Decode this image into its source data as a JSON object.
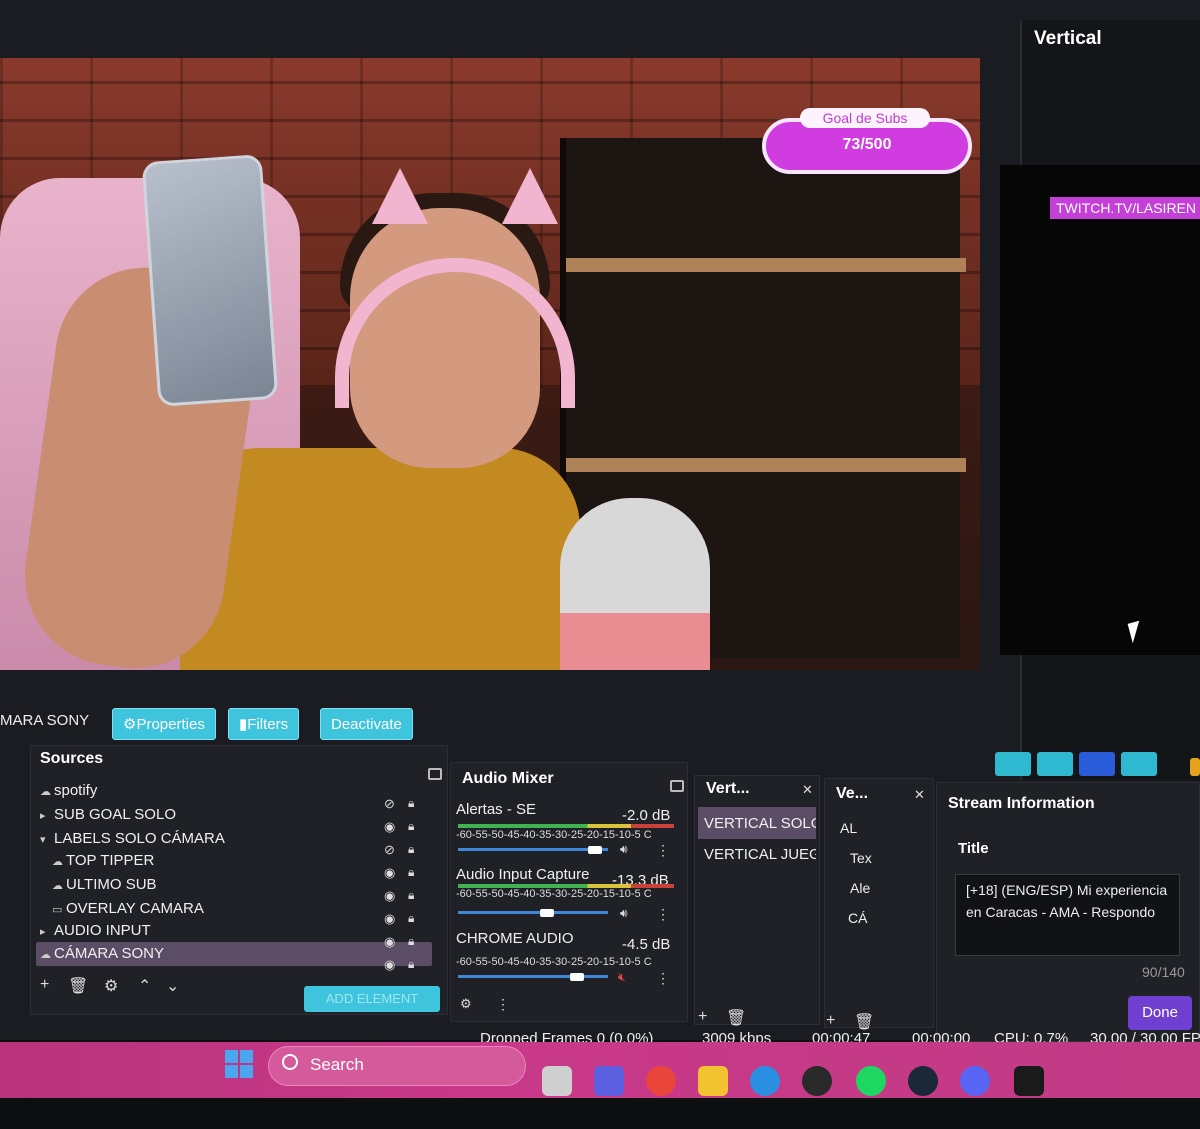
{
  "preview": {
    "goal_title": "Goal de Subs",
    "goal_value": "73/500"
  },
  "vertical": {
    "title": "Vertical",
    "overlay_text": "TWITCH.TV/LASIREN"
  },
  "source_toolbar": {
    "source_name": "MARA SONY",
    "properties": "Properties",
    "filters": "Filters",
    "deactivate": "Deactivate"
  },
  "sources": {
    "title": "Sources",
    "items": [
      {
        "label": "spotify"
      },
      {
        "label": "SUB GOAL SOLO"
      },
      {
        "label": "LABELS SOLO CÁMARA"
      },
      {
        "label": "TOP TIPPER"
      },
      {
        "label": "ULTIMO SUB"
      },
      {
        "label": "OVERLAY CAMARA"
      },
      {
        "label": "AUDIO INPUT"
      },
      {
        "label": "CÁMARA SONY"
      }
    ],
    "add_element": "ADD ELEMENT"
  },
  "audio_mixer": {
    "title": "Audio Mixer",
    "scale": "-60-55-50-45-40-35-30-25-20-15-10-5 C",
    "channels": [
      {
        "name": "Alertas - SE",
        "db": "-2.0 dB",
        "level": 0.95
      },
      {
        "name": "Audio Input Capture",
        "db": "-13.3 dB",
        "level": 0.6
      },
      {
        "name": "CHROME AUDIO",
        "db": "-4.5 dB",
        "level": 0.8
      }
    ]
  },
  "vert_dock": {
    "title": "Vert...",
    "items": [
      "VERTICAL SOLO",
      "VERTICAL JUEG"
    ]
  },
  "ve_dock": {
    "title": "Ve...",
    "items": [
      "AL",
      "Tex",
      "Ale",
      "CÁ"
    ]
  },
  "stream_info": {
    "title": "Stream Information",
    "field_label": "Title",
    "title_value": "[+18] (ENG/ESP) Mi experiencia en Caracas - AMA - Respondo",
    "char_count": "90/140",
    "done": "Done"
  },
  "status": {
    "dropped": "Dropped Frames 0 (0.0%)",
    "bitrate": "3009 kbps",
    "live_time": "00:00:47",
    "rec_time": "00:00:00",
    "cpu": "CPU: 0.7%",
    "fps": "30.00 / 30.00 FP"
  },
  "taskbar": {
    "search": "Search"
  },
  "colors": {
    "accent_teal": "#3ec4dd",
    "goal_magenta": "#d13ce0",
    "done_purple": "#6e3fd1",
    "taskbar_pink": "#c9398a"
  }
}
